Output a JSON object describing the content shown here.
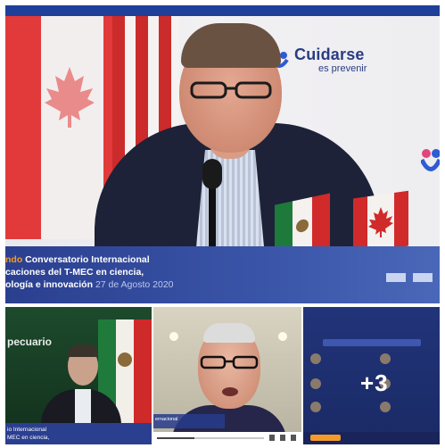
{
  "window": {
    "top_bar_color": "#1e3f9a",
    "accent_orange": "#f39a2b"
  },
  "main_speaker": {
    "logo": {
      "icon": "cuidarse-heart-logo-icon",
      "title": "Cuidarse",
      "subtitle": "es prevenir"
    },
    "banner": {
      "line1_highlight": "ndo",
      "line1_rest": " Conversatorio Internacional",
      "line2": "caciones del T-MEC en ciencia,",
      "line3": "ología e innovación",
      "date": "27 de Agosto 2020"
    }
  },
  "tiles": {
    "tile1": {
      "label": "pecuario",
      "caption_line1": "io Internacional",
      "caption_line2": "MEC en ciencia,"
    },
    "tile2": {
      "caption": "ernacional",
      "progress": 0.35
    },
    "tile3": {
      "plus_more": "+3"
    }
  }
}
